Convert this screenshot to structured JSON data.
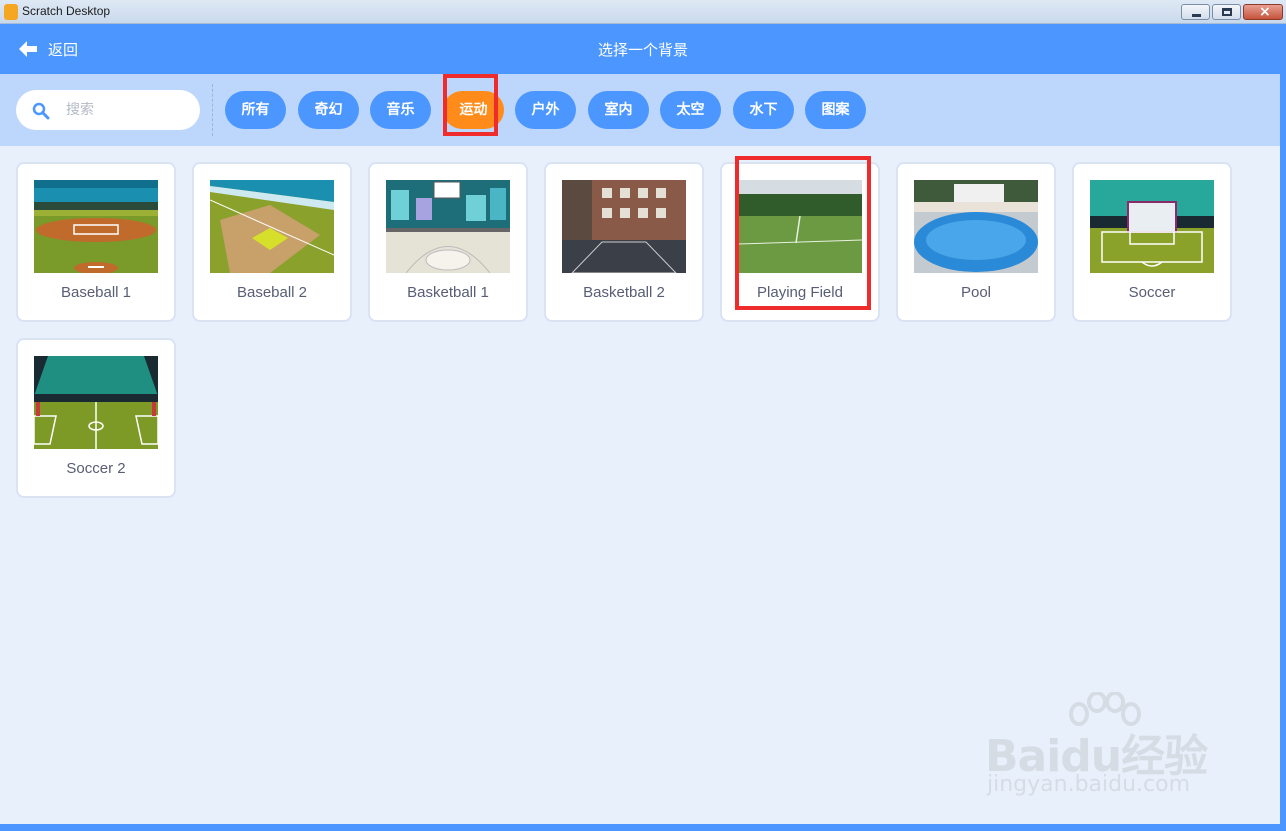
{
  "window": {
    "title": "Scratch Desktop"
  },
  "header": {
    "back_label": "返回",
    "title": "选择一个背景"
  },
  "search": {
    "placeholder": "搜索",
    "value": ""
  },
  "tags": [
    "所有",
    "奇幻",
    "音乐",
    "运动",
    "户外",
    "室内",
    "太空",
    "水下",
    "图案"
  ],
  "active_tag": "运动",
  "backdrops": [
    "Baseball 1",
    "Baseball 2",
    "Basketball 1",
    "Basketball 2",
    "Playing Field",
    "Pool",
    "Soccer",
    "Soccer 2"
  ],
  "watermark": {
    "main": "Baidu经验",
    "sub": "jingyan.baidu.com"
  },
  "colors": {
    "header_blue": "#4c97ff",
    "filter_bar": "#bdd6fb",
    "active_tag": "#ff8c1a",
    "highlight_red": "#ef2b2b",
    "background": "#e8f0fb"
  }
}
